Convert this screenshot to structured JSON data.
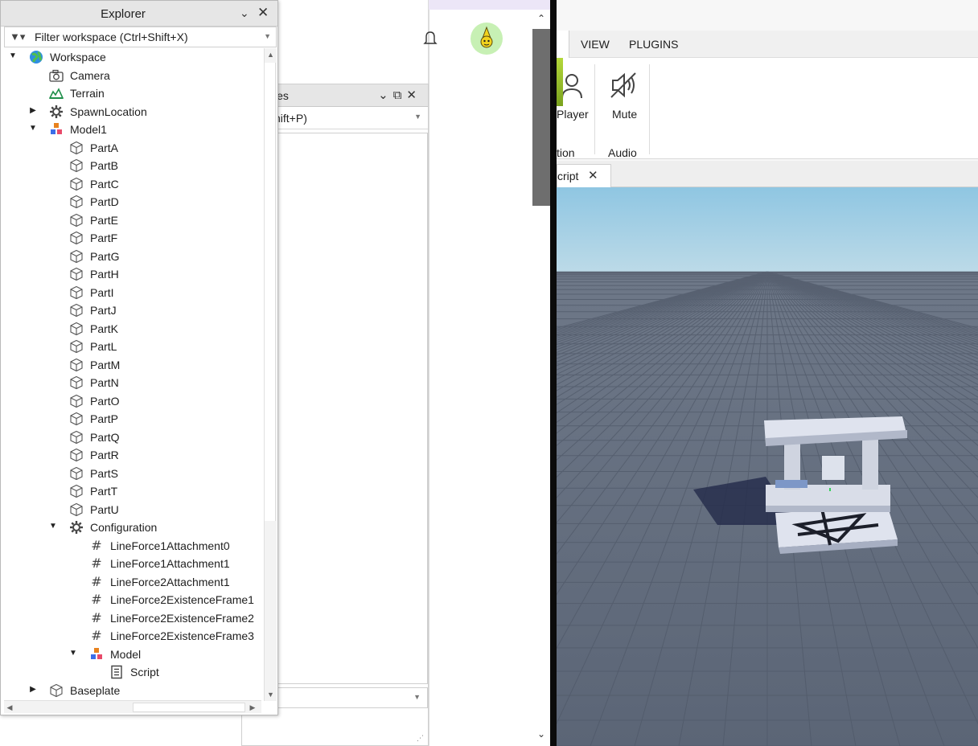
{
  "explorer": {
    "title": "Explorer",
    "filter_placeholder": "Filter workspace (Ctrl+Shift+X)",
    "tree": [
      {
        "label": "Workspace",
        "depth": 0,
        "toggle": "expanded",
        "icon": "globe-icon"
      },
      {
        "label": "Camera",
        "depth": 1,
        "toggle": "none",
        "icon": "camera-icon"
      },
      {
        "label": "Terrain",
        "depth": 1,
        "toggle": "none",
        "icon": "terrain-icon"
      },
      {
        "label": "SpawnLocation",
        "depth": 1,
        "toggle": "collapsed",
        "icon": "spawn-icon"
      },
      {
        "label": "Model1",
        "depth": 1,
        "toggle": "expanded",
        "icon": "model-icon"
      },
      {
        "label": "PartA",
        "depth": 2,
        "toggle": "none",
        "icon": "part-icon"
      },
      {
        "label": "PartB",
        "depth": 2,
        "toggle": "none",
        "icon": "part-icon"
      },
      {
        "label": "PartC",
        "depth": 2,
        "toggle": "none",
        "icon": "part-icon"
      },
      {
        "label": "PartD",
        "depth": 2,
        "toggle": "none",
        "icon": "part-icon"
      },
      {
        "label": "PartE",
        "depth": 2,
        "toggle": "none",
        "icon": "part-icon"
      },
      {
        "label": "PartF",
        "depth": 2,
        "toggle": "none",
        "icon": "part-icon"
      },
      {
        "label": "PartG",
        "depth": 2,
        "toggle": "none",
        "icon": "part-icon"
      },
      {
        "label": "PartH",
        "depth": 2,
        "toggle": "none",
        "icon": "part-icon"
      },
      {
        "label": "PartI",
        "depth": 2,
        "toggle": "none",
        "icon": "part-icon"
      },
      {
        "label": "PartJ",
        "depth": 2,
        "toggle": "none",
        "icon": "part-icon"
      },
      {
        "label": "PartK",
        "depth": 2,
        "toggle": "none",
        "icon": "part-icon"
      },
      {
        "label": "PartL",
        "depth": 2,
        "toggle": "none",
        "icon": "part-icon"
      },
      {
        "label": "PartM",
        "depth": 2,
        "toggle": "none",
        "icon": "part-icon"
      },
      {
        "label": "PartN",
        "depth": 2,
        "toggle": "none",
        "icon": "part-icon"
      },
      {
        "label": "PartO",
        "depth": 2,
        "toggle": "none",
        "icon": "part-icon"
      },
      {
        "label": "PartP",
        "depth": 2,
        "toggle": "none",
        "icon": "part-icon"
      },
      {
        "label": "PartQ",
        "depth": 2,
        "toggle": "none",
        "icon": "part-icon"
      },
      {
        "label": "PartR",
        "depth": 2,
        "toggle": "none",
        "icon": "part-icon"
      },
      {
        "label": "PartS",
        "depth": 2,
        "toggle": "none",
        "icon": "part-icon"
      },
      {
        "label": "PartT",
        "depth": 2,
        "toggle": "none",
        "icon": "part-icon"
      },
      {
        "label": "PartU",
        "depth": 2,
        "toggle": "none",
        "icon": "part-icon"
      },
      {
        "label": "Configuration",
        "depth": 2,
        "toggle": "expanded",
        "icon": "gear-icon"
      },
      {
        "label": "LineForce1Attachment0",
        "depth": 3,
        "toggle": "none",
        "icon": "hash-icon"
      },
      {
        "label": "LineForce1Attachment1",
        "depth": 3,
        "toggle": "none",
        "icon": "hash-icon"
      },
      {
        "label": "LineForce2Attachment1",
        "depth": 3,
        "toggle": "none",
        "icon": "hash-icon"
      },
      {
        "label": "LineForce2ExistenceFrame1",
        "depth": 3,
        "toggle": "none",
        "icon": "hash-icon"
      },
      {
        "label": "LineForce2ExistenceFrame2",
        "depth": 3,
        "toggle": "none",
        "icon": "hash-icon"
      },
      {
        "label": "LineForce2ExistenceFrame3",
        "depth": 3,
        "toggle": "none",
        "icon": "hash-icon"
      },
      {
        "label": "Model",
        "depth": 3,
        "toggle": "expanded",
        "icon": "model-icon"
      },
      {
        "label": "Script",
        "depth": 4,
        "toggle": "none",
        "icon": "script-icon"
      },
      {
        "label": "Baseplate",
        "depth": 1,
        "toggle": "collapsed",
        "icon": "part-icon"
      }
    ]
  },
  "properties": {
    "title_fragment": "ies",
    "filter_fragment": "hift+P)"
  },
  "ribbon": {
    "tabs": [
      "VIEW",
      "PLUGINS"
    ],
    "buttons": [
      {
        "label": "Player",
        "icon": "player-icon"
      },
      {
        "label": "Mute",
        "icon": "mute-icon"
      }
    ],
    "groups": [
      {
        "label": "tion"
      },
      {
        "label": "Audio"
      }
    ]
  },
  "document_tab": {
    "label": "cript"
  },
  "colors": {
    "accent_green": "#c7f0b4",
    "model_orange": "#e8821e",
    "model_blue": "#3b6ee8",
    "model_red": "#e84a6a"
  }
}
